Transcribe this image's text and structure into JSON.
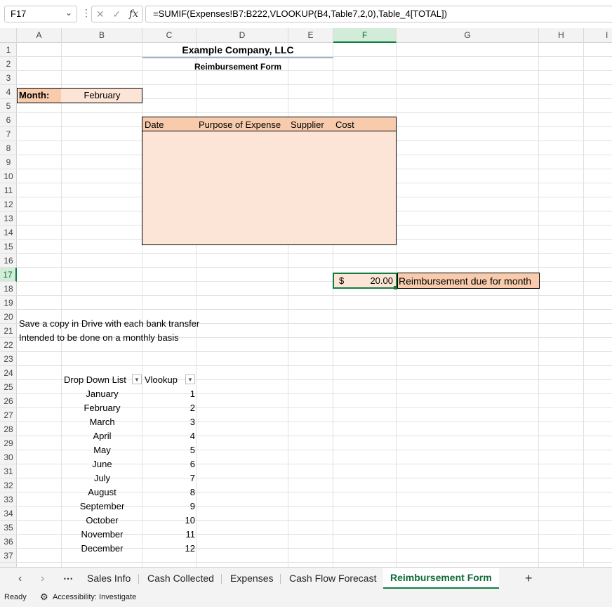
{
  "formula_bar": {
    "name_box": "F17",
    "formula": "=SUMIF(Expenses!B7:B222,VLOOKUP(B4,Table7,2,0),Table_4[TOTAL])"
  },
  "columns": [
    "A",
    "B",
    "C",
    "D",
    "E",
    "F",
    "G",
    "H",
    "I"
  ],
  "rows": [
    "1",
    "2",
    "3",
    "4",
    "5",
    "6",
    "7",
    "8",
    "9",
    "10",
    "11",
    "12",
    "13",
    "14",
    "15",
    "16",
    "17",
    "18",
    "19",
    "20",
    "21",
    "22",
    "23",
    "24",
    "25",
    "26",
    "27",
    "28",
    "29",
    "30",
    "31",
    "32",
    "33",
    "34",
    "35",
    "36",
    "37"
  ],
  "sheet": {
    "company": "Example Company, LLC",
    "form_title": "Reimbursement Form",
    "month_label": "Month:",
    "month_value": "February",
    "table_headers": [
      "Date",
      "Purpose of Expense",
      "Supplier",
      "Cost"
    ],
    "reimbursement_currency": "$",
    "reimbursement_amount": "20.00",
    "reimbursement_label": "Reimbursement due for month",
    "note1": "Save a copy in Drive with each bank transfer",
    "note2": "Intended to be done on a monthly basis",
    "lookup_headers": [
      "Drop Down List",
      "Vlookup"
    ],
    "lookup_rows": [
      {
        "month": "January",
        "num": "1"
      },
      {
        "month": "February",
        "num": "2"
      },
      {
        "month": "March",
        "num": "3"
      },
      {
        "month": "April",
        "num": "4"
      },
      {
        "month": "May",
        "num": "5"
      },
      {
        "month": "June",
        "num": "6"
      },
      {
        "month": "July",
        "num": "7"
      },
      {
        "month": "August",
        "num": "8"
      },
      {
        "month": "September",
        "num": "9"
      },
      {
        "month": "October",
        "num": "10"
      },
      {
        "month": "November",
        "num": "11"
      },
      {
        "month": "December",
        "num": "12"
      }
    ]
  },
  "tabs": [
    "Sales Info",
    "Cash Collected",
    "Expenses",
    "Cash Flow Forecast",
    "Reimbursement Form"
  ],
  "active_tab": "Reimbursement Form",
  "status": {
    "ready": "Ready",
    "accessibility": "Accessibility: Investigate"
  },
  "colors": {
    "accent": "#107c41",
    "fill_light": "#fce4d6",
    "fill_header": "#f8cbad"
  }
}
